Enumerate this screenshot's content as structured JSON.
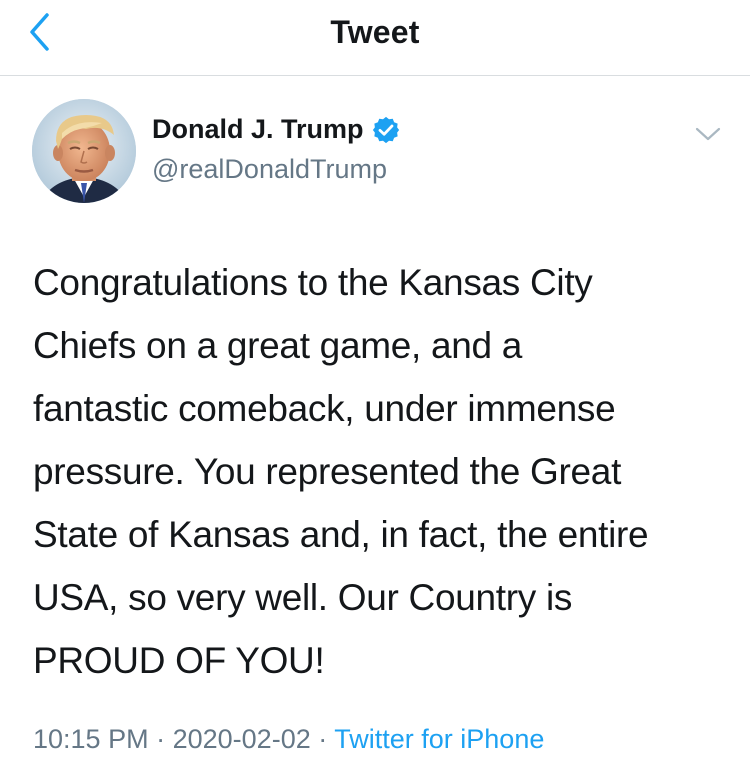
{
  "nav": {
    "title": "Tweet",
    "back_icon": "chevron-left-icon",
    "accent_color": "#1da1f2"
  },
  "author": {
    "name": "Donald J. Trump",
    "handle": "@realDonaldTrump",
    "verified": true,
    "verified_icon": "verified-badge-icon"
  },
  "tweet": {
    "lines": [
      "Congratulations to the Kansas City",
      "Chiefs on a great game, and a",
      "fantastic comeback, under immense",
      "pressure. You represented the Great",
      "State of Kansas and, in fact, the entire",
      "USA, so very well. Our Country is",
      "PROUD OF YOU!"
    ],
    "time": "10:15 PM",
    "separator": "·",
    "date": "2020-02-02",
    "source": "Twitter for iPhone"
  },
  "colors": {
    "text_primary": "#14171a",
    "text_secondary": "#657786",
    "link": "#1da1f2",
    "divider": "#d9dde0"
  }
}
